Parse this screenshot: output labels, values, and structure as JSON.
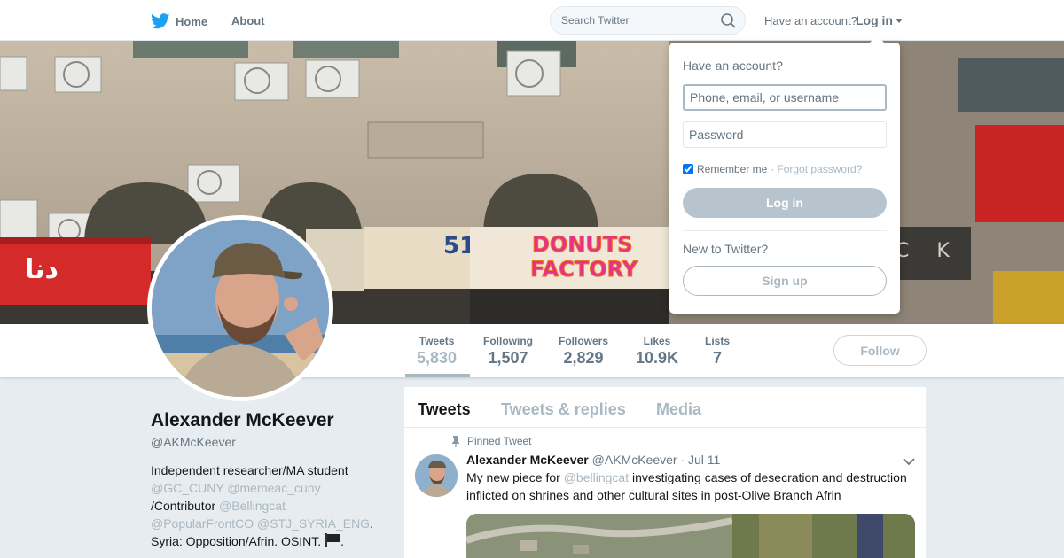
{
  "nav": {
    "home_label": "Home",
    "about_label": "About",
    "search_placeholder": "Search Twitter",
    "have_account": "Have an account?",
    "login_label": "Log in"
  },
  "banner": {
    "sign_donuts_1": "DONUTS",
    "sign_donuts_2": "FACTORY",
    "sign_number": "51",
    "sign_ck": "C K"
  },
  "profile_nav": {
    "stats": [
      {
        "label": "Tweets",
        "value": "5,830"
      },
      {
        "label": "Following",
        "value": "1,507"
      },
      {
        "label": "Followers",
        "value": "2,829"
      },
      {
        "label": "Likes",
        "value": "10.9K"
      },
      {
        "label": "Lists",
        "value": "7"
      }
    ],
    "follow_label": "Follow"
  },
  "profile": {
    "name": "Alexander McKeever",
    "handle": "@AKMcKeever",
    "bio_line1": "Independent researcher/MA student",
    "bio_link1": "@GC_CUNY",
    "bio_link2": "@memeac_cuny",
    "bio_text2": "/Contributor",
    "bio_link3": "@Bellingcat",
    "bio_link4": "@PopularFrontCO",
    "bio_link5": "@STJ_SYRIA_ENG",
    "bio_period": ".",
    "bio_line_last": "Syria: Opposition/Afrin. OSINT.",
    "bio_end": "."
  },
  "timeline": {
    "tabs": [
      "Tweets",
      "Tweets & replies",
      "Media"
    ],
    "pinned_label": "Pinned Tweet",
    "tweet": {
      "name": "Alexander McKeever",
      "handle": "@AKMcKeever",
      "sep": "·",
      "date": "Jul 11",
      "text_before": "My new piece for",
      "mention": "@bellingcat",
      "text_after": "investigating cases of desecration and destruction inflicted on shrines and other cultural sites in post-Olive Branch Afrin"
    }
  },
  "login_dropdown": {
    "title": "Have an account?",
    "username_placeholder": "Phone, email, or username",
    "password_placeholder": "Password",
    "remember_label": "Remember me",
    "dot": "·",
    "forgot_label": "Forgot password?",
    "login_button": "Log in",
    "new_label": "New to Twitter?",
    "signup_button": "Sign up"
  },
  "colors": {
    "twitter_blue": "#1da1f2",
    "muted_text": "#657786",
    "link_muted": "#aab8c2"
  }
}
